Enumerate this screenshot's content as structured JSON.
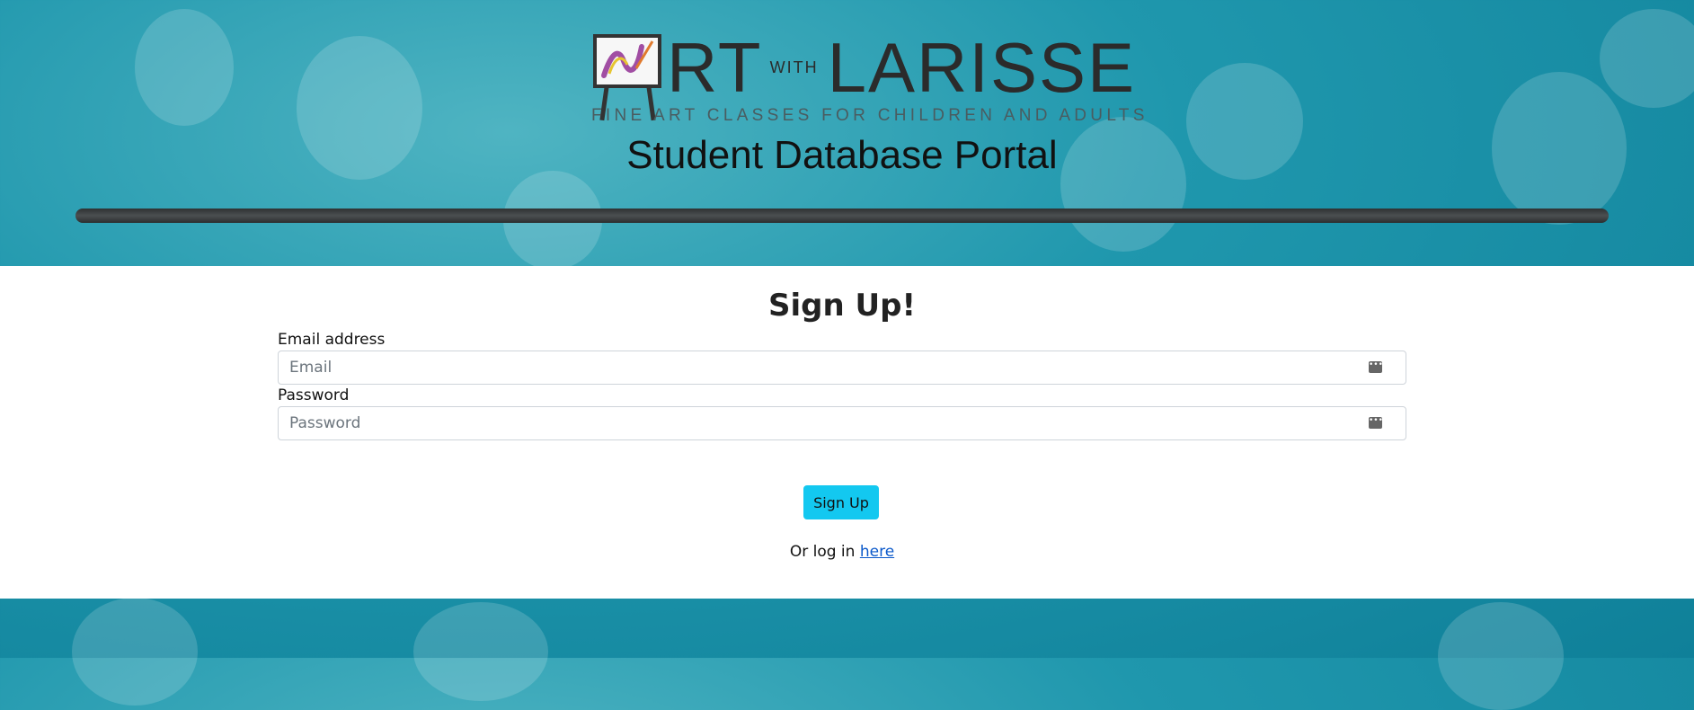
{
  "header": {
    "logo_title_art": "RT",
    "logo_title_with": "WITH",
    "logo_title_name": "LARISSE",
    "logo_tagline": "FINE ART CLASSES FOR CHILDREN AND ADULTS",
    "portal_title": "Student Database Portal"
  },
  "form": {
    "heading": "Sign Up!",
    "email": {
      "label": "Email address",
      "placeholder": "Email",
      "value": ""
    },
    "password": {
      "label": "Password",
      "placeholder": "Password",
      "value": ""
    },
    "submit_label": "Sign Up",
    "login_prefix": "Or log in",
    "login_link": "here"
  },
  "colors": {
    "accent_button": "#13c8f0",
    "link": "#0a58ca",
    "background_teal": "#1f97ad"
  },
  "icons": {
    "field_icon": "password-manager-icon"
  }
}
